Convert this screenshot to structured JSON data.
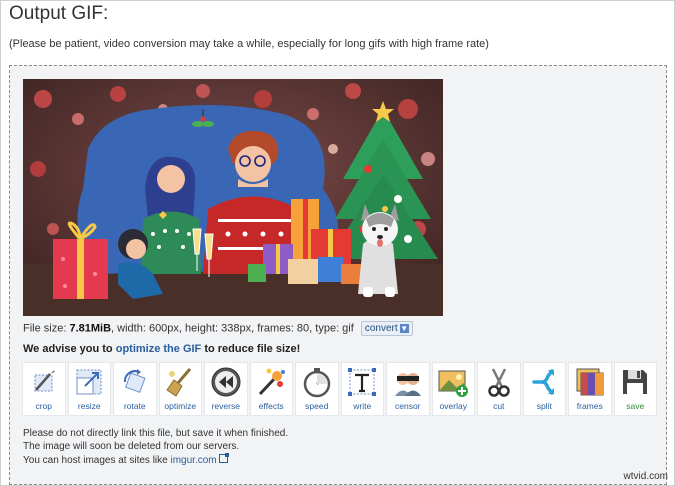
{
  "page": {
    "title": "Output GIF:",
    "note": "(Please be patient, video conversion may take a while, especially for long gifs with high frame rate)"
  },
  "info": {
    "file_size_label": "File size: ",
    "file_size_value": "7.81MiB",
    "rest": ", width: 600px, height: 338px, frames: 80, type: gif",
    "convert_label": "convert"
  },
  "advise": {
    "prefix": "We advise you to ",
    "link": "optimize the GIF",
    "suffix": " to reduce file size!"
  },
  "tools": [
    {
      "label": "crop",
      "icon": "crop-icon"
    },
    {
      "label": "resize",
      "icon": "resize-icon"
    },
    {
      "label": "rotate",
      "icon": "rotate-icon"
    },
    {
      "label": "optimize",
      "icon": "broom-icon"
    },
    {
      "label": "reverse",
      "icon": "rewind-icon"
    },
    {
      "label": "effects",
      "icon": "magic-wand-icon"
    },
    {
      "label": "speed",
      "icon": "stopwatch-icon"
    },
    {
      "label": "write",
      "icon": "text-icon"
    },
    {
      "label": "censor",
      "icon": "censor-faces-icon"
    },
    {
      "label": "overlay",
      "icon": "image-overlay-icon"
    },
    {
      "label": "cut",
      "icon": "scissors-icon"
    },
    {
      "label": "split",
      "icon": "split-icon"
    },
    {
      "label": "frames",
      "icon": "frames-icon"
    },
    {
      "label": "save",
      "icon": "floppy-disk-icon"
    }
  ],
  "footer": {
    "line1": "Please do not directly link this file, but save it when finished.",
    "line2": "The image will soon be deleted from our servers.",
    "line3_prefix": "You can host images at sites like ",
    "line3_link": "imgur.com"
  },
  "watermark": "wtvid.com",
  "colors": {
    "link": "#2a5e9e",
    "save": "#2e8b2e",
    "panel_bg": "#f2f3f5"
  }
}
